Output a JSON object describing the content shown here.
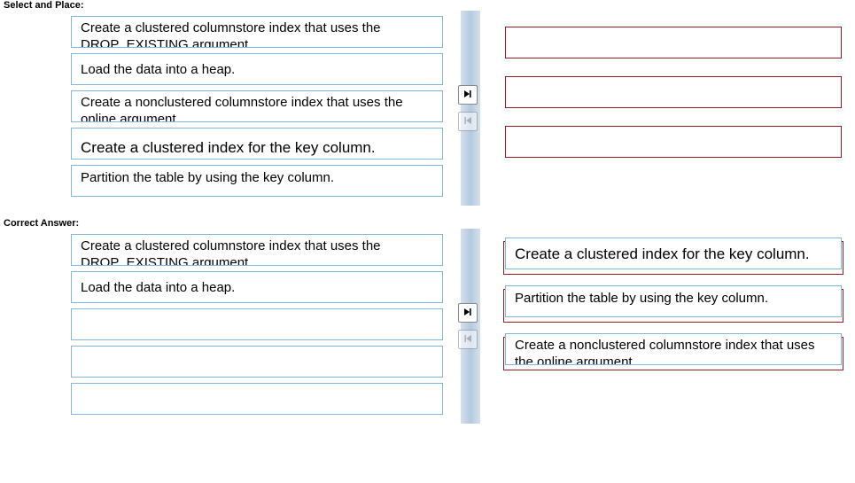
{
  "labels": {
    "select_and_place": "Select and Place:",
    "correct_answer": "Correct Answer:"
  },
  "icons": {
    "move_right": "move-right-icon",
    "move_left": "move-left-icon"
  },
  "question": {
    "source_items": [
      "Create a clustered columnstore index that uses the DROP_EXISTING argument.",
      "Load the data into a heap.",
      "Create a nonclustered columnstore index that uses the online argument",
      "Create a clustered index for the key column.",
      "Partition the table by using the key column."
    ],
    "target_slots": [
      "",
      "",
      ""
    ]
  },
  "answer": {
    "source_remaining": [
      "Create a clustered columnstore index that uses the DROP_EXISTING argument.",
      "Load the data into a heap.",
      "",
      "",
      ""
    ],
    "target_items": [
      "Create a clustered index for the key column.",
      "Partition the table by using the key column.",
      "Create a nonclustered columnstore index that uses the online argument"
    ]
  }
}
